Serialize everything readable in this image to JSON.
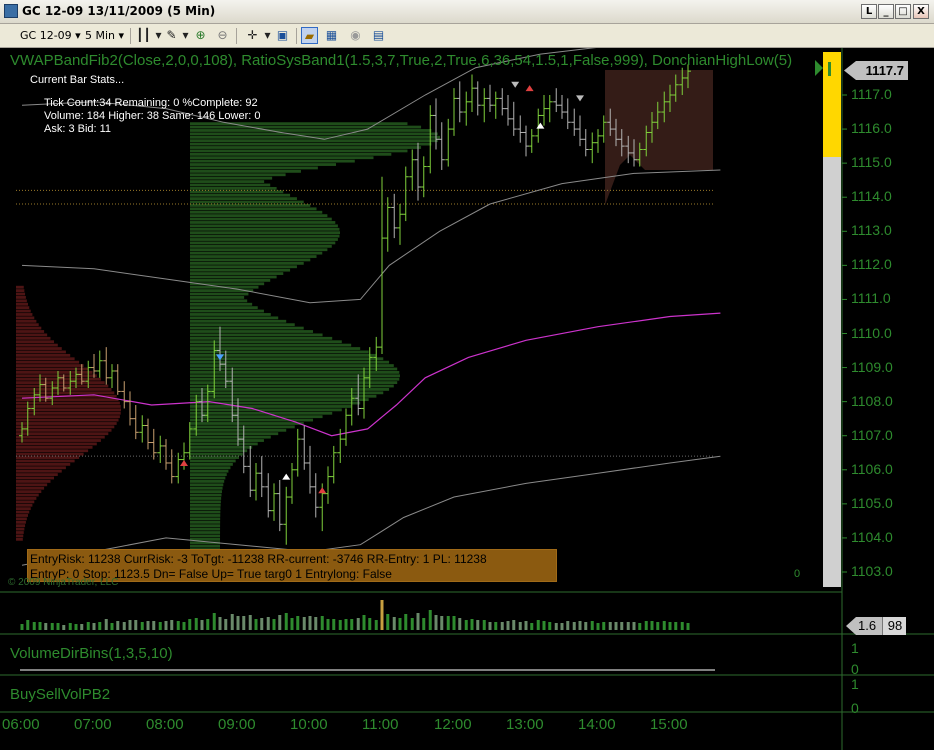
{
  "window": {
    "title": "GC 12-09  13/11/2009 (5 Min)",
    "buttons": [
      "L",
      "_",
      "□",
      "X"
    ]
  },
  "toolbar": {
    "instrument": "GC 12-09",
    "interval": "5 Min"
  },
  "chart": {
    "indicator_title": "VWAPBandFib2(Close,2,0,0,108),  RatioSysBand1(1.5,3,7,True,2,True,6,36,54,1.5,1,False,999),  DonchianHighLow(5)",
    "current_price": "1117.7",
    "copyright": "© 2009 NinjaTrader, LLC",
    "zero_marker": "0",
    "stats": {
      "header": "Current Bar Stats...",
      "line1": "Tick Count:34  Remaining: 0  %Complete: 92",
      "line2": "Volume: 184  Higher: 38   Same: 146  Lower: 0",
      "line3": "Ask: 3   Bid: 11"
    },
    "info_box": {
      "line1": "EntryRisk:  11238  CurrRisk:  -3  ToTgt:  -11238  RR-current:  -3746  RR-Entry:  1  PL:  11238",
      "line2": "EntryP:  0  Stop:  1123.5  Dn= False  Up= True  targ0  1  Entrylong:  False"
    },
    "colors": {
      "background": "#000000",
      "label_green": "#2e8b2e",
      "vwap": "#cc33cc",
      "band": "#8a8a8a",
      "up_bar": "#7fd13b",
      "down_bar": "#b3b3b3",
      "profile_green": "#1f4d1a",
      "profile_red": "#4d1414",
      "gauge_yellow": "#ffd700"
    }
  },
  "panels": {
    "volume_value": "1.6",
    "volume_value2": "98",
    "volume_dir_label": "VolumeDirBins(1,3,5,10)",
    "buysell_label": "BuySellVolPB2",
    "vd_axis": [
      "1",
      "0"
    ],
    "bs_axis": [
      "1",
      "0"
    ]
  },
  "chart_data": {
    "type": "candlestick",
    "title": "GC 12-09  13/11/2009 (5 Min)",
    "y_ticks": [
      "1117.0",
      "1116.0",
      "1115.0",
      "1114.0",
      "1113.0",
      "1112.0",
      "1111.0",
      "1110.0",
      "1109.0",
      "1108.0",
      "1107.0",
      "1106.0",
      "1105.0",
      "1104.0",
      "1103.0"
    ],
    "x_ticks": [
      "06:00",
      "07:00",
      "08:00",
      "09:00",
      "10:00",
      "11:00",
      "12:00",
      "13:00",
      "14:00",
      "15:00"
    ],
    "ylim": [
      1102.6,
      1117.9
    ],
    "vwap": [
      [
        6.0,
        1108.1
      ],
      [
        7.0,
        1108.2
      ],
      [
        7.8,
        1107.9
      ],
      [
        8.6,
        1108.0
      ],
      [
        9.2,
        1107.8
      ],
      [
        9.8,
        1107.4
      ],
      [
        10.3,
        1107.0
      ],
      [
        10.8,
        1107.2
      ],
      [
        11.2,
        1107.9
      ],
      [
        11.6,
        1108.7
      ],
      [
        12.2,
        1109.3
      ],
      [
        13.0,
        1109.8
      ],
      [
        14.0,
        1110.2
      ],
      [
        15.0,
        1110.5
      ],
      [
        15.7,
        1110.6
      ]
    ],
    "upper_band": [
      [
        6.0,
        1116.7
      ],
      [
        7.0,
        1116.8
      ],
      [
        8.0,
        1116.6
      ],
      [
        8.8,
        1116.2
      ],
      [
        9.6,
        1115.9
      ],
      [
        10.2,
        1115.7
      ],
      [
        10.8,
        1116.0
      ],
      [
        11.6,
        1117.0
      ],
      [
        12.3,
        1117.8
      ],
      [
        13.2,
        1118.2
      ],
      [
        14.0,
        1118.4
      ],
      [
        15.0,
        1118.6
      ]
    ],
    "lower_band": [
      [
        6.0,
        1112.0
      ],
      [
        7.0,
        1111.9
      ],
      [
        8.0,
        1111.6
      ],
      [
        9.0,
        1111.3
      ],
      [
        10.0,
        1110.9
      ],
      [
        10.7,
        1111.0
      ],
      [
        11.1,
        1112.0
      ],
      [
        11.8,
        1113.0
      ],
      [
        12.5,
        1113.8
      ],
      [
        13.5,
        1114.4
      ],
      [
        14.5,
        1114.7
      ],
      [
        15.7,
        1114.8
      ]
    ],
    "lower_band2": [
      [
        6.0,
        1103.2
      ],
      [
        7.0,
        1103.6
      ],
      [
        8.0,
        1104.0
      ],
      [
        9.0,
        1103.8
      ],
      [
        10.0,
        1103.6
      ],
      [
        10.7,
        1103.8
      ],
      [
        11.3,
        1104.6
      ],
      [
        12.0,
        1105.2
      ],
      [
        13.0,
        1105.6
      ],
      [
        14.0,
        1105.9
      ],
      [
        15.0,
        1106.2
      ],
      [
        15.7,
        1106.4
      ]
    ],
    "horizontal_lines": [
      1114.2,
      1113.8,
      1106.4
    ],
    "candles": [
      [
        6.0,
        1107.0,
        1107.4,
        1106.8,
        1107.2
      ],
      [
        6.08,
        1107.2,
        1108.0,
        1107.0,
        1107.8
      ],
      [
        6.17,
        1107.8,
        1108.4,
        1107.6,
        1108.2
      ],
      [
        6.25,
        1108.2,
        1108.8,
        1108.0,
        1108.5
      ],
      [
        6.33,
        1108.5,
        1108.7,
        1108.0,
        1108.1
      ],
      [
        6.42,
        1108.1,
        1108.6,
        1107.9,
        1108.4
      ],
      [
        6.5,
        1108.4,
        1108.9,
        1108.2,
        1108.7
      ],
      [
        6.58,
        1108.7,
        1108.8,
        1108.3,
        1108.4
      ],
      [
        6.67,
        1108.4,
        1108.9,
        1108.2,
        1108.6
      ],
      [
        6.75,
        1108.6,
        1109.0,
        1108.4,
        1108.8
      ],
      [
        6.83,
        1108.8,
        1109.1,
        1108.5,
        1108.6
      ],
      [
        6.92,
        1108.6,
        1109.2,
        1108.4,
        1109.0
      ],
      [
        7.0,
        1109.0,
        1109.4,
        1108.7,
        1108.9
      ],
      [
        7.08,
        1108.9,
        1109.5,
        1108.7,
        1109.2
      ],
      [
        7.17,
        1109.2,
        1109.6,
        1108.5,
        1108.7
      ],
      [
        7.25,
        1108.7,
        1109.1,
        1108.4,
        1108.9
      ],
      [
        7.33,
        1108.9,
        1109.1,
        1108.2,
        1108.3
      ],
      [
        7.42,
        1108.3,
        1108.6,
        1107.8,
        1108.0
      ],
      [
        7.5,
        1108.0,
        1108.3,
        1107.3,
        1107.5
      ],
      [
        7.58,
        1107.5,
        1107.9,
        1106.9,
        1107.1
      ],
      [
        7.67,
        1107.1,
        1107.6,
        1106.8,
        1107.3
      ],
      [
        7.75,
        1107.3,
        1107.5,
        1106.6,
        1106.8
      ],
      [
        7.83,
        1106.8,
        1107.2,
        1106.3,
        1106.5
      ],
      [
        7.92,
        1106.5,
        1107.0,
        1106.2,
        1106.7
      ],
      [
        8.0,
        1106.7,
        1106.9,
        1106.0,
        1106.2
      ],
      [
        8.08,
        1106.2,
        1106.6,
        1105.6,
        1105.8
      ],
      [
        8.17,
        1105.8,
        1106.5,
        1105.6,
        1106.3
      ],
      [
        8.25,
        1106.3,
        1106.8,
        1106.0,
        1106.5
      ],
      [
        8.33,
        1106.5,
        1107.4,
        1106.3,
        1107.2
      ],
      [
        8.42,
        1107.2,
        1108.2,
        1107.0,
        1108.0
      ],
      [
        8.5,
        1108.0,
        1108.4,
        1107.4,
        1107.6
      ],
      [
        8.58,
        1107.6,
        1108.5,
        1107.4,
        1108.3
      ],
      [
        8.67,
        1108.3,
        1109.8,
        1108.1,
        1109.5
      ],
      [
        8.75,
        1109.5,
        1110.2,
        1108.9,
        1109.1
      ],
      [
        8.83,
        1109.1,
        1109.5,
        1108.4,
        1108.6
      ],
      [
        8.92,
        1108.6,
        1109.0,
        1107.4,
        1107.6
      ],
      [
        9.0,
        1107.6,
        1108.1,
        1106.7,
        1106.9
      ],
      [
        9.08,
        1106.9,
        1107.3,
        1105.9,
        1106.1
      ],
      [
        9.17,
        1106.1,
        1106.7,
        1105.2,
        1105.4
      ],
      [
        9.25,
        1105.4,
        1106.2,
        1105.1,
        1105.9
      ],
      [
        9.33,
        1105.9,
        1106.4,
        1105.2,
        1105.5
      ],
      [
        9.42,
        1105.5,
        1105.9,
        1104.6,
        1104.8
      ],
      [
        9.5,
        1104.8,
        1105.6,
        1104.5,
        1105.3
      ],
      [
        9.58,
        1105.3,
        1105.7,
        1104.2,
        1104.4
      ],
      [
        9.67,
        1104.4,
        1105.5,
        1103.8,
        1105.2
      ],
      [
        9.75,
        1105.2,
        1106.2,
        1105.0,
        1106.0
      ],
      [
        9.83,
        1106.0,
        1107.2,
        1105.8,
        1106.9
      ],
      [
        9.92,
        1106.9,
        1107.3,
        1106.0,
        1106.2
      ],
      [
        10.0,
        1106.2,
        1106.7,
        1105.3,
        1105.5
      ],
      [
        10.08,
        1105.5,
        1105.9,
        1104.6,
        1104.9
      ],
      [
        10.17,
        1104.9,
        1105.6,
        1104.2,
        1105.3
      ],
      [
        10.25,
        1105.3,
        1106.1,
        1105.0,
        1105.8
      ],
      [
        10.33,
        1105.8,
        1106.7,
        1105.6,
        1106.5
      ],
      [
        10.42,
        1106.5,
        1107.2,
        1106.2,
        1106.9
      ],
      [
        10.5,
        1106.9,
        1107.8,
        1106.7,
        1107.6
      ],
      [
        10.58,
        1107.6,
        1108.4,
        1107.3,
        1108.1
      ],
      [
        10.67,
        1108.1,
        1108.8,
        1107.6,
        1107.8
      ],
      [
        10.75,
        1107.8,
        1109.0,
        1107.5,
        1108.7
      ],
      [
        10.83,
        1108.7,
        1109.6,
        1108.4,
        1109.3
      ],
      [
        10.92,
        1109.3,
        1109.9,
        1108.9,
        1109.6
      ],
      [
        11.0,
        1109.6,
        1114.6,
        1109.4,
        1112.8
      ],
      [
        11.08,
        1112.8,
        1114.0,
        1112.4,
        1113.7
      ],
      [
        11.17,
        1113.7,
        1114.1,
        1112.8,
        1113.1
      ],
      [
        11.25,
        1113.1,
        1113.8,
        1112.6,
        1113.5
      ],
      [
        11.33,
        1113.5,
        1114.9,
        1113.3,
        1114.6
      ],
      [
        11.42,
        1114.6,
        1115.4,
        1114.2,
        1115.1
      ],
      [
        11.5,
        1115.1,
        1115.6,
        1113.9,
        1114.3
      ],
      [
        11.58,
        1114.3,
        1115.2,
        1114.0,
        1114.9
      ],
      [
        11.67,
        1114.9,
        1116.7,
        1114.7,
        1116.4
      ],
      [
        11.75,
        1116.4,
        1116.9,
        1115.4,
        1115.7
      ],
      [
        11.83,
        1115.7,
        1116.2,
        1114.8,
        1115.1
      ],
      [
        11.92,
        1115.1,
        1116.3,
        1114.9,
        1116.0
      ],
      [
        12.0,
        1116.0,
        1117.2,
        1115.8,
        1116.9
      ],
      [
        12.08,
        1116.9,
        1117.4,
        1116.2,
        1116.5
      ],
      [
        12.17,
        1116.5,
        1117.1,
        1116.1,
        1116.8
      ],
      [
        12.25,
        1116.8,
        1117.6,
        1116.5,
        1117.2
      ],
      [
        12.33,
        1117.2,
        1117.4,
        1116.4,
        1116.7
      ],
      [
        12.42,
        1116.7,
        1117.2,
        1116.2,
        1116.9
      ],
      [
        12.5,
        1116.9,
        1117.3,
        1116.5,
        1116.7
      ],
      [
        12.58,
        1116.7,
        1117.1,
        1116.3,
        1116.9
      ],
      [
        12.67,
        1116.9,
        1117.2,
        1116.4,
        1116.6
      ],
      [
        12.75,
        1116.6,
        1117.0,
        1116.1,
        1116.3
      ],
      [
        12.83,
        1116.3,
        1116.8,
        1115.8,
        1116.0
      ],
      [
        12.92,
        1116.0,
        1116.4,
        1115.6,
        1115.9
      ],
      [
        13.0,
        1115.9,
        1116.1,
        1115.2,
        1115.5
      ],
      [
        13.08,
        1115.5,
        1116.0,
        1115.3,
        1115.8
      ],
      [
        13.17,
        1115.8,
        1116.6,
        1115.6,
        1116.4
      ],
      [
        13.25,
        1116.4,
        1117.0,
        1116.1,
        1116.6
      ],
      [
        13.33,
        1116.6,
        1117.0,
        1116.2,
        1116.8
      ],
      [
        13.42,
        1116.8,
        1117.2,
        1116.5,
        1116.7
      ],
      [
        13.5,
        1116.7,
        1117.0,
        1116.3,
        1116.5
      ],
      [
        13.58,
        1116.5,
        1116.9,
        1116.0,
        1116.2
      ],
      [
        13.67,
        1116.2,
        1116.6,
        1115.8,
        1116.0
      ],
      [
        13.75,
        1116.0,
        1116.4,
        1115.5,
        1115.7
      ],
      [
        13.83,
        1115.7,
        1116.0,
        1115.2,
        1115.4
      ],
      [
        13.92,
        1115.4,
        1115.9,
        1115.0,
        1115.6
      ],
      [
        14.0,
        1115.6,
        1116.0,
        1115.3,
        1115.8
      ],
      [
        14.08,
        1115.8,
        1116.4,
        1115.6,
        1116.2
      ],
      [
        14.17,
        1116.2,
        1116.6,
        1115.8,
        1116.0
      ],
      [
        14.25,
        1116.0,
        1116.3,
        1115.5,
        1115.7
      ],
      [
        14.33,
        1115.7,
        1116.0,
        1115.2,
        1115.5
      ],
      [
        14.42,
        1115.5,
        1115.8,
        1115.0,
        1115.3
      ],
      [
        14.5,
        1115.3,
        1115.7,
        1114.9,
        1115.1
      ],
      [
        14.58,
        1115.1,
        1115.6,
        1114.9,
        1115.4
      ],
      [
        14.67,
        1115.4,
        1116.1,
        1115.2,
        1115.9
      ],
      [
        14.75,
        1115.9,
        1116.5,
        1115.6,
        1116.2
      ],
      [
        14.83,
        1116.2,
        1116.8,
        1116.0,
        1116.5
      ],
      [
        14.92,
        1116.5,
        1117.1,
        1116.2,
        1116.8
      ],
      [
        15.0,
        1116.8,
        1117.3,
        1116.5,
        1117.0
      ],
      [
        15.08,
        1117.0,
        1117.6,
        1116.8,
        1117.3
      ],
      [
        15.17,
        1117.3,
        1117.8,
        1117.0,
        1117.5
      ],
      [
        15.25,
        1117.5,
        1117.9,
        1117.2,
        1117.7
      ]
    ]
  }
}
